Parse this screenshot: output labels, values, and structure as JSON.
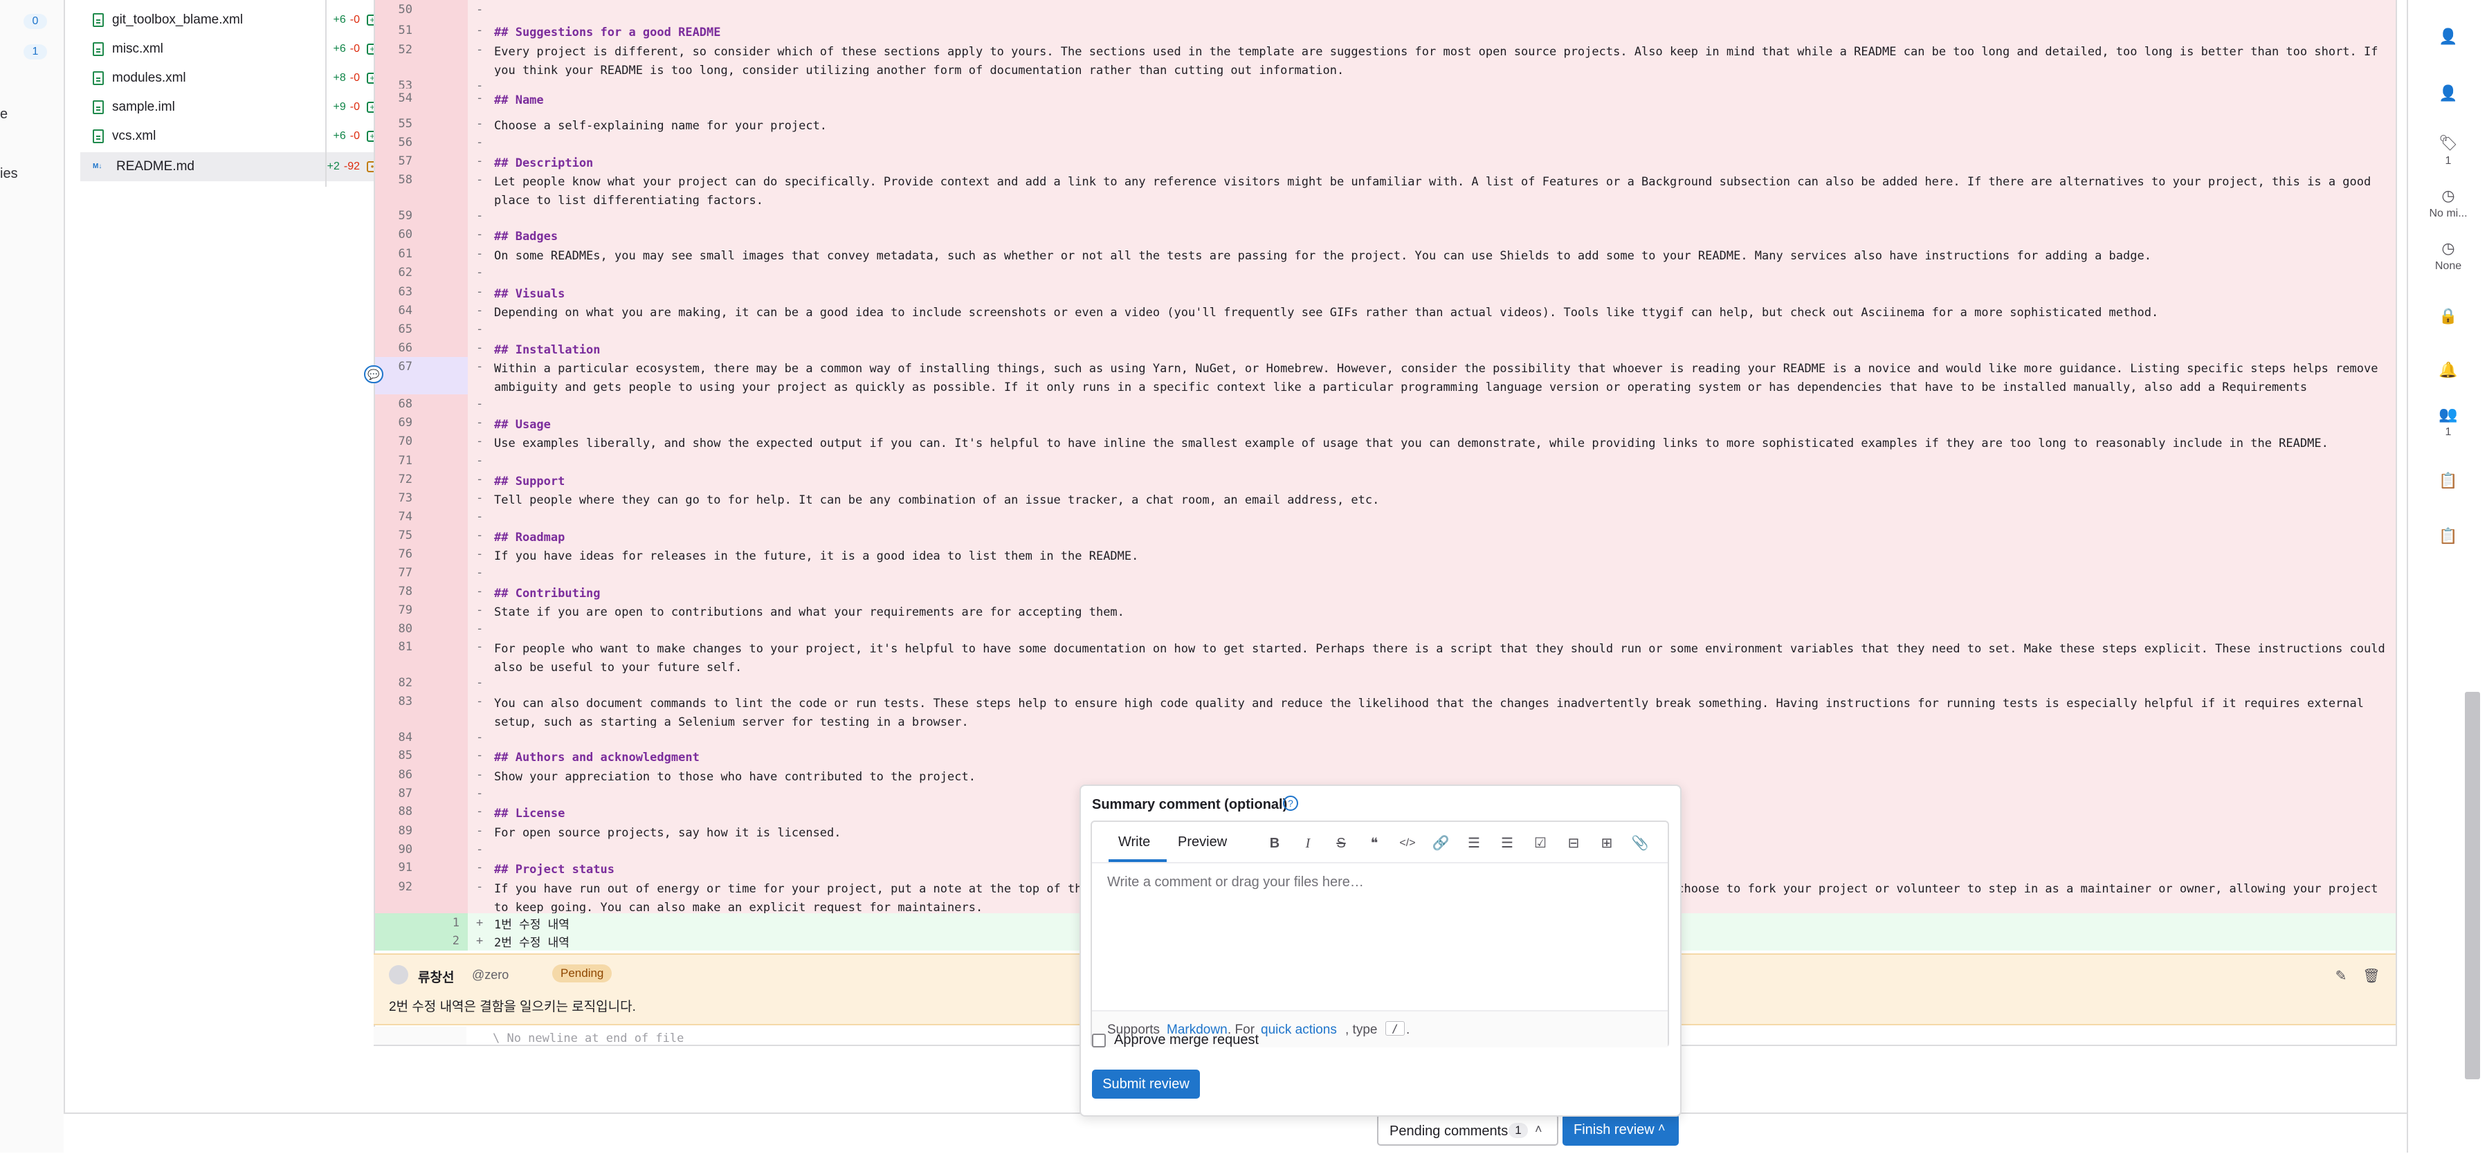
{
  "nav": {
    "count_a": "0",
    "count_b": "1",
    "frag_a": "e",
    "frag_b": "ies"
  },
  "files": [
    {
      "name": "git_toolbox_blame.xml",
      "added": "+6",
      "removed": "-0",
      "badge": "+"
    },
    {
      "name": "misc.xml",
      "added": "+6",
      "removed": "-0",
      "badge": "+"
    },
    {
      "name": "modules.xml",
      "added": "+8",
      "removed": "-0",
      "badge": "+"
    },
    {
      "name": "sample.iml",
      "added": "+9",
      "removed": "-0",
      "badge": "+"
    },
    {
      "name": "vcs.xml",
      "added": "+6",
      "removed": "-0",
      "badge": "+"
    },
    {
      "name": "README.md",
      "added": "+2",
      "removed": "-92",
      "badge": "•",
      "md_tag": "M↓"
    }
  ],
  "diff_lines": [
    {
      "old": "50",
      "new": "",
      "sign": "-",
      "text": "",
      "head": false
    },
    {
      "old": "51",
      "new": "",
      "sign": "-",
      "text": "## Suggestions for a good README",
      "head": true
    },
    {
      "old": "52",
      "new": "",
      "sign": "-",
      "text": "Every project is different, so consider which of these sections apply to yours. The sections used in the template are suggestions for most open source projects. Also keep in mind that while a README can be too long and detailed, too long is better than too short. If you think your README is too long, consider utilizing another form of documentation rather than cutting out information.",
      "head": false
    },
    {
      "old": "53",
      "new": "",
      "sign": "-",
      "text": "",
      "head": false
    },
    {
      "old": "54",
      "new": "",
      "sign": "-",
      "text": "## Name",
      "head": true
    },
    {
      "old": "55",
      "new": "",
      "sign": "-",
      "text": "Choose a self-explaining name for your project.",
      "head": false
    },
    {
      "old": "56",
      "new": "",
      "sign": "-",
      "text": "",
      "head": false
    },
    {
      "old": "57",
      "new": "",
      "sign": "-",
      "text": "## Description",
      "head": true
    },
    {
      "old": "58",
      "new": "",
      "sign": "-",
      "text": "Let people know what your project can do specifically. Provide context and add a link to any reference visitors might be unfamiliar with. A list of Features or a Background subsection can also be added here. If there are alternatives to your project, this is a good place to list differentiating factors.",
      "head": false
    },
    {
      "old": "59",
      "new": "",
      "sign": "-",
      "text": "",
      "head": false
    },
    {
      "old": "60",
      "new": "",
      "sign": "-",
      "text": "## Badges",
      "head": true
    },
    {
      "old": "61",
      "new": "",
      "sign": "-",
      "text": "On some READMEs, you may see small images that convey metadata, such as whether or not all the tests are passing for the project. You can use Shields to add some to your README. Many services also have instructions for adding a badge.",
      "head": false
    },
    {
      "old": "62",
      "new": "",
      "sign": "-",
      "text": "",
      "head": false
    },
    {
      "old": "63",
      "new": "",
      "sign": "-",
      "text": "## Visuals",
      "head": true
    },
    {
      "old": "64",
      "new": "",
      "sign": "-",
      "text": "Depending on what you are making, it can be a good idea to include screenshots or even a video (you'll frequently see GIFs rather than actual videos). Tools like ttygif can help, but check out Asciinema for a more sophisticated method.",
      "head": false
    },
    {
      "old": "65",
      "new": "",
      "sign": "-",
      "text": "",
      "head": false
    },
    {
      "old": "66",
      "new": "",
      "sign": "-",
      "text": "## Installation",
      "head": true
    },
    {
      "old": "67",
      "new": "",
      "sign": "-",
      "text": "Within a particular ecosystem, there may be a common way of installing things, such as using Yarn, NuGet, or Homebrew. However, consider the possibility that whoever is reading your README is a novice and would like more guidance. Listing specific steps helps remove ambiguity and gets people to using your project as quickly as possible. If it only runs in a specific context like a particular programming language version or operating system or has dependencies that have to be installed manually, also add a Requirements subsection.",
      "head": false
    },
    {
      "old": "68",
      "new": "",
      "sign": "-",
      "text": "",
      "head": false
    },
    {
      "old": "69",
      "new": "",
      "sign": "-",
      "text": "## Usage",
      "head": true
    },
    {
      "old": "70",
      "new": "",
      "sign": "-",
      "text": "Use examples liberally, and show the expected output if you can. It's helpful to have inline the smallest example of usage that you can demonstrate, while providing links to more sophisticated examples if they are too long to reasonably include in the README.",
      "head": false
    },
    {
      "old": "71",
      "new": "",
      "sign": "-",
      "text": "",
      "head": false
    },
    {
      "old": "72",
      "new": "",
      "sign": "-",
      "text": "## Support",
      "head": true
    },
    {
      "old": "73",
      "new": "",
      "sign": "-",
      "text": "Tell people where they can go to for help. It can be any combination of an issue tracker, a chat room, an email address, etc.",
      "head": false
    },
    {
      "old": "74",
      "new": "",
      "sign": "-",
      "text": "",
      "head": false
    },
    {
      "old": "75",
      "new": "",
      "sign": "-",
      "text": "## Roadmap",
      "head": true
    },
    {
      "old": "76",
      "new": "",
      "sign": "-",
      "text": "If you have ideas for releases in the future, it is a good idea to list them in the README.",
      "head": false
    },
    {
      "old": "77",
      "new": "",
      "sign": "-",
      "text": "",
      "head": false
    },
    {
      "old": "78",
      "new": "",
      "sign": "-",
      "text": "## Contributing",
      "head": true
    },
    {
      "old": "79",
      "new": "",
      "sign": "-",
      "text": "State if you are open to contributions and what your requirements are for accepting them.",
      "head": false
    },
    {
      "old": "80",
      "new": "",
      "sign": "-",
      "text": "",
      "head": false
    },
    {
      "old": "81",
      "new": "",
      "sign": "-",
      "text": "For people who want to make changes to your project, it's helpful to have some documentation on how to get started. Perhaps there is a script that they should run or some environment variables that they need to set. Make these steps explicit. These instructions could also be useful to your future self.",
      "head": false
    },
    {
      "old": "82",
      "new": "",
      "sign": "-",
      "text": "",
      "head": false
    },
    {
      "old": "83",
      "new": "",
      "sign": "-",
      "text": "You can also document commands to lint the code or run tests. These steps help to ensure high code quality and reduce the likelihood that the changes inadvertently break something. Having instructions for running tests is especially helpful if it requires external setup, such as starting a Selenium server for testing in a browser.",
      "head": false
    },
    {
      "old": "84",
      "new": "",
      "sign": "-",
      "text": "",
      "head": false
    },
    {
      "old": "85",
      "new": "",
      "sign": "-",
      "text": "## Authors and acknowledgment",
      "head": true
    },
    {
      "old": "86",
      "new": "",
      "sign": "-",
      "text": "Show your appreciation to those who have contributed to the project.",
      "head": false
    },
    {
      "old": "87",
      "new": "",
      "sign": "-",
      "text": "",
      "head": false
    },
    {
      "old": "88",
      "new": "",
      "sign": "-",
      "text": "## License",
      "head": true
    },
    {
      "old": "89",
      "new": "",
      "sign": "-",
      "text": "For open source projects, say how it is licensed.",
      "head": false
    },
    {
      "old": "90",
      "new": "",
      "sign": "-",
      "text": "",
      "head": false
    },
    {
      "old": "91",
      "new": "",
      "sign": "-",
      "text": "## Project status",
      "head": true
    },
    {
      "old": "92",
      "new": "",
      "sign": "-",
      "text": "If you have run out of energy or time for your project, put a note at the top of the README saying that development has slowed down or stopped completely. Someone may choose to fork your project or volunteer to step in as a maintainer or owner, allowing your project to keep going. You can also make an explicit request for maintainers.",
      "head": false
    },
    {
      "old": "",
      "new": "1",
      "sign": "+",
      "text": "1번 수정 내역",
      "head": false
    },
    {
      "old": "",
      "new": "2",
      "sign": "+",
      "text": "2번 수정 내역",
      "head": false
    }
  ],
  "note": {
    "author": "류창선",
    "handle": "@zero",
    "badge": "Pending",
    "text": "2번 수정 내역은 결함을 일으키는 로직입니다."
  },
  "eof_text": "\\ No newline at end of file",
  "right_sidebar": {
    "labels_count": "1",
    "milestone": "No mi...",
    "time": "None",
    "participants": "1"
  },
  "popover": {
    "title": "Summary comment (optional)",
    "tab_write": "Write",
    "tab_preview": "Preview",
    "placeholder": "Write a comment or drag your files here…",
    "footer_supports": "Supports",
    "footer_markdown": "Markdown",
    "footer_for": ". For",
    "footer_quick": "quick actions",
    "footer_type": ", type",
    "footer_slash": "/",
    "footer_end": ".",
    "approve_label": "Approve merge request",
    "submit_label": "Submit review"
  },
  "bottom": {
    "pending_label": "Pending comments",
    "pending_count": "1",
    "finish_label": "Finish review"
  }
}
